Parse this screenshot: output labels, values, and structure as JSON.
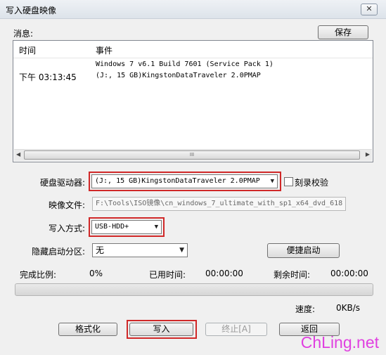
{
  "window": {
    "title": "写入硬盘映像",
    "close_label": "✕"
  },
  "messages": {
    "label": "消息:",
    "save_button": "保存",
    "columns": {
      "time": "时间",
      "event": "事件"
    },
    "rows": [
      {
        "time": "",
        "event": "Windows 7 v6.1 Build 7601 (Service Pack 1)"
      },
      {
        "time": "下午 03:13:45",
        "event": "(J:, 15 GB)KingstonDataTraveler 2.0PMAP"
      }
    ],
    "scroll_grip": "III"
  },
  "drive": {
    "label": "硬盘驱动器:",
    "value": "(J:, 15 GB)KingstonDataTraveler 2.0PMAP"
  },
  "verify": {
    "label": "刻录校验",
    "checked": false
  },
  "image_file": {
    "label": "映像文件:",
    "value": "F:\\Tools\\ISO镜像\\cn_windows_7_ultimate_with_sp1_x64_dvd_618"
  },
  "write_method": {
    "label": "写入方式:",
    "value": "USB-HDD+"
  },
  "hidden_partition": {
    "label": "隐藏启动分区:",
    "value": "无"
  },
  "quick_boot_button": "便捷启动",
  "status": {
    "complete_label": "完成比例:",
    "complete_value": "0%",
    "elapsed_label": "已用时间:",
    "elapsed_value": "00:00:00",
    "remaining_label": "剩余时间:",
    "remaining_value": "00:00:00",
    "progress": 0,
    "speed_label": "速度:",
    "speed_value": "0KB/s"
  },
  "buttons": {
    "format": "格式化",
    "write": "写入",
    "terminate": "终止[A]",
    "back": "返回"
  },
  "watermark": "ChLing.net"
}
